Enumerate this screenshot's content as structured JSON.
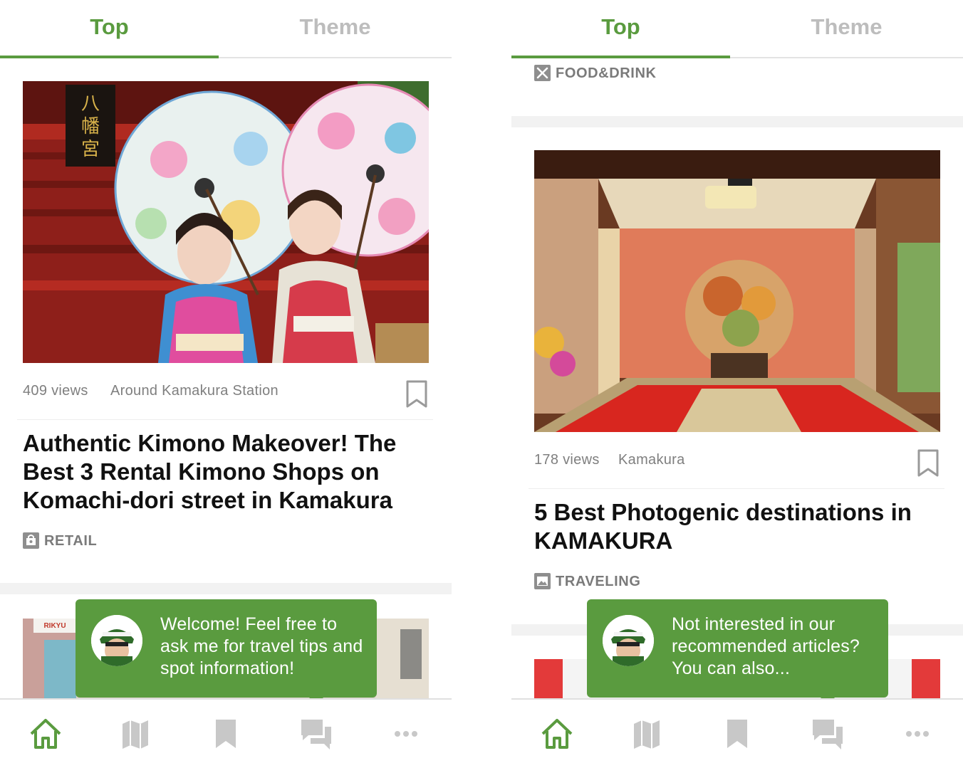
{
  "colors": {
    "accent": "#5a9b3f",
    "inactive": "#bdbdbd",
    "meta": "#7f7f7f",
    "icon_gray": "#c8c8c8"
  },
  "screens": [
    {
      "tabs": {
        "top": "Top",
        "theme": "Theme"
      },
      "article": {
        "views": "409 views",
        "area": "Around Kamakura Station",
        "title": "Authentic Kimono Makeover! The Best 3 Rental Kimono Shops on Komachi-dori street in Kamakura",
        "category": "RETAIL",
        "image": "photo of two women in kimono holding paper umbrellas at a shrine"
      },
      "next_card_sign": "RIKYU",
      "bubble": {
        "message": "Welcome! Feel free to ask me for travel tips and spot information!"
      },
      "nav": [
        "home-icon",
        "map-icon",
        "bookmark-icon",
        "chat-icon",
        "more-icon"
      ]
    },
    {
      "tabs": {
        "top": "Top",
        "theme": "Theme"
      },
      "prev_category": "FOOD&DRINK",
      "article": {
        "views": "178 views",
        "area": "Kamakura",
        "title": "5 Best Photogenic destinations in KAMAKURA",
        "category": "TRAVELING",
        "image": "photo of a Japanese temple room with a round window"
      },
      "bubble": {
        "message": "Not interested in our recommended articles? You can also..."
      },
      "nav": [
        "home-icon",
        "map-icon",
        "bookmark-icon",
        "chat-icon",
        "more-icon"
      ]
    }
  ]
}
